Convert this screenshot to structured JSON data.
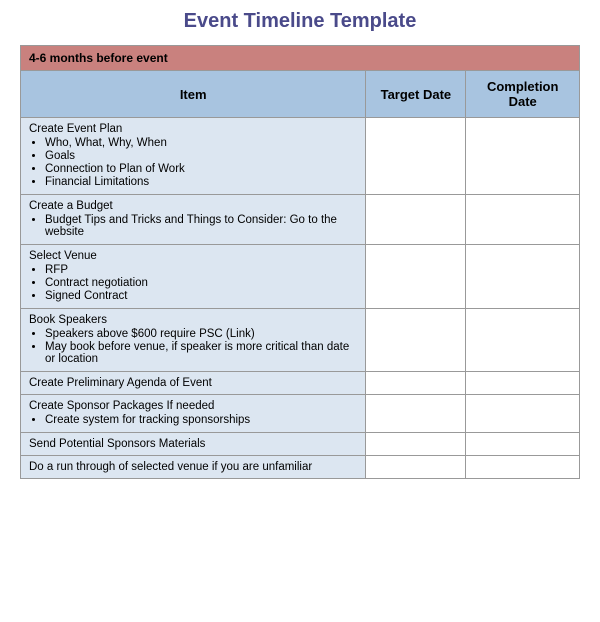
{
  "title": "Event Timeline Template",
  "section1": {
    "label": "4-6 months before event"
  },
  "columns": {
    "item": "Item",
    "targetDate": "Target Date",
    "completionDate": "Completion Date"
  },
  "rows": [
    {
      "title": "Create Event Plan",
      "bullets": [
        "Who, What, Why, When",
        "Goals",
        "Connection to Plan of Work",
        "Financial Limitations"
      ]
    },
    {
      "title": "Create a Budget",
      "bullets": [
        "Budget Tips and Tricks and Things to Consider: Go to the website"
      ]
    },
    {
      "title": "Select Venue",
      "bullets": [
        "RFP",
        "Contract negotiation",
        "Signed Contract"
      ]
    },
    {
      "title": "Book Speakers",
      "bullets": [
        "Speakers above $600 require PSC (Link)",
        "May book before venue, if speaker is more critical than date or location"
      ]
    },
    {
      "title": "Create Preliminary Agenda of Event",
      "bullets": []
    },
    {
      "title": "Create Sponsor Packages If needed",
      "bullets": [
        "Create system for tracking sponsorships"
      ]
    },
    {
      "title": "Send Potential Sponsors Materials",
      "bullets": []
    },
    {
      "title": "Do a run through of selected venue if you are unfamiliar",
      "bullets": []
    }
  ]
}
